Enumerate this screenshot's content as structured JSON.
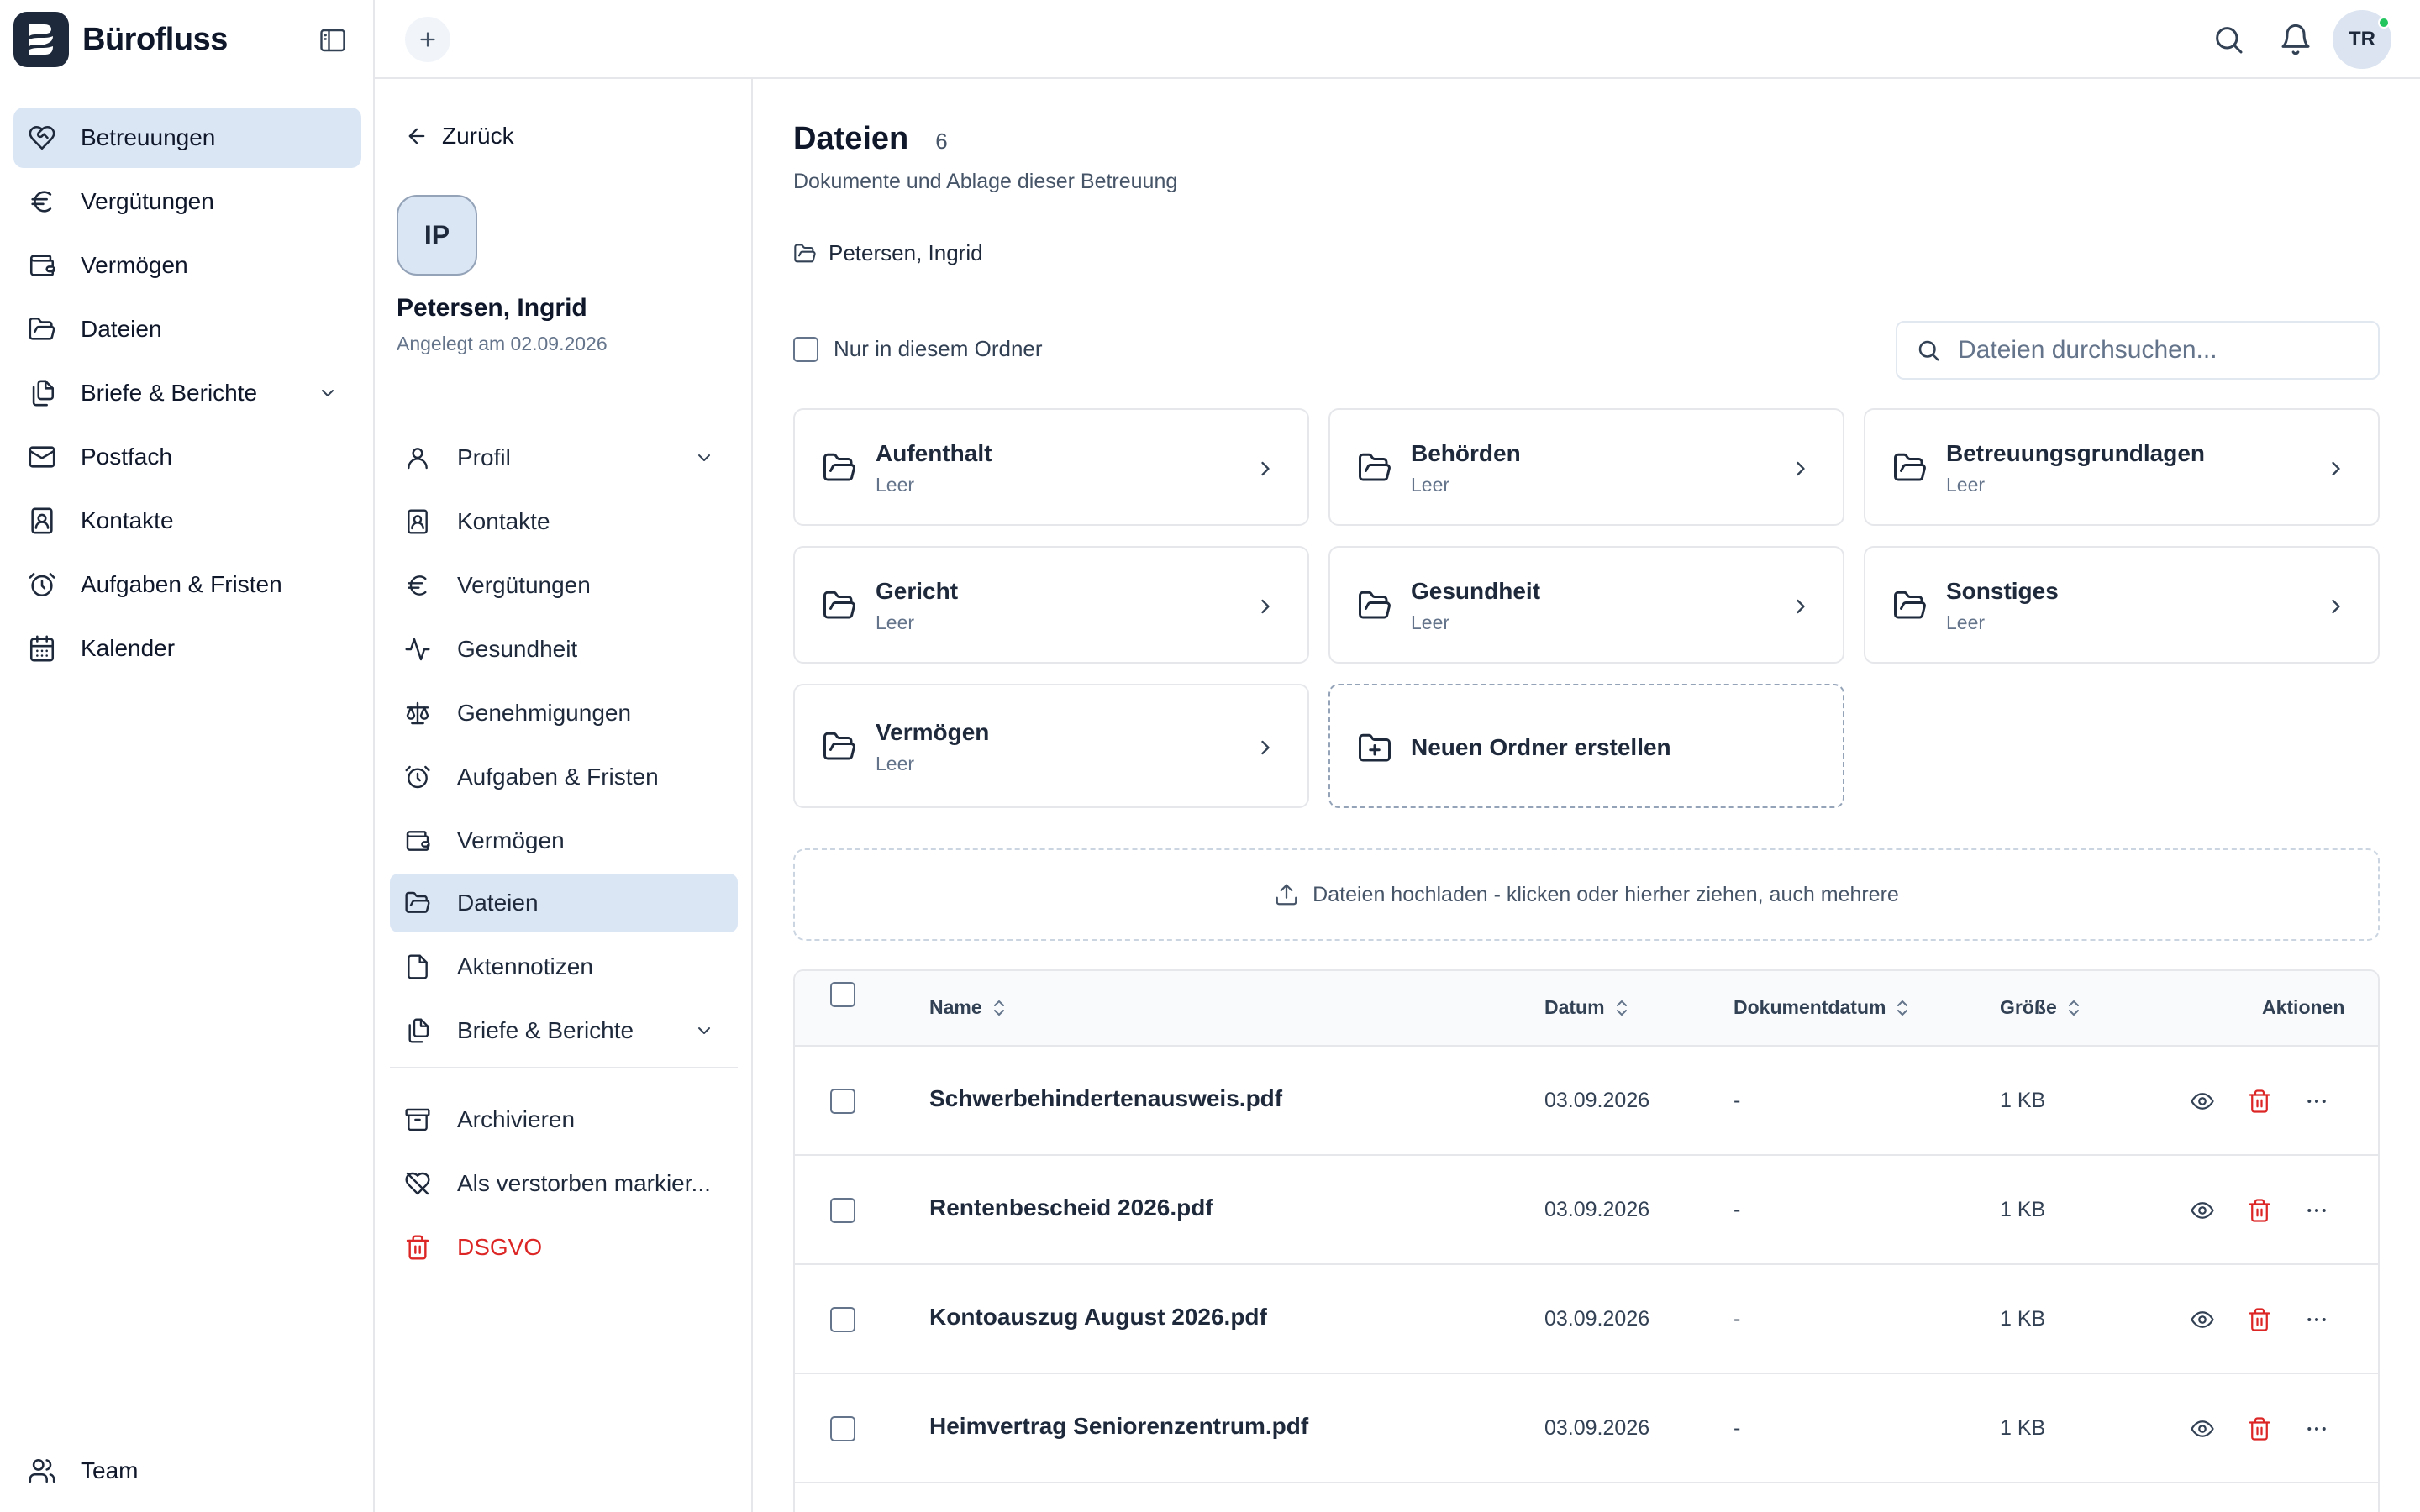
{
  "app": {
    "brand": "Bürofluss"
  },
  "user": {
    "initials": "TR"
  },
  "sidebar": {
    "items": [
      {
        "label": "Betreuungen",
        "icon": "heart-handshake-icon",
        "active": true
      },
      {
        "label": "Vergütungen",
        "icon": "euro-icon"
      },
      {
        "label": "Vermögen",
        "icon": "wallet-icon"
      },
      {
        "label": "Dateien",
        "icon": "folder-open-icon"
      },
      {
        "label": "Briefe & Berichte",
        "icon": "files-icon",
        "expandable": true
      },
      {
        "label": "Postfach",
        "icon": "mail-icon"
      },
      {
        "label": "Kontakte",
        "icon": "contact-icon"
      },
      {
        "label": "Aufgaben & Fristen",
        "icon": "alarm-clock-icon"
      },
      {
        "label": "Kalender",
        "icon": "calendar-icon"
      }
    ],
    "footer": {
      "label": "Team",
      "icon": "users-icon"
    }
  },
  "detail": {
    "back_label": "Zurück",
    "avatar_initials": "IP",
    "name": "Petersen, Ingrid",
    "created": "Angelegt am 02.09.2026",
    "items": [
      {
        "label": "Profil",
        "icon": "user-icon",
        "expandable": true
      },
      {
        "label": "Kontakte",
        "icon": "contact-icon"
      },
      {
        "label": "Vergütungen",
        "icon": "euro-icon"
      },
      {
        "label": "Gesundheit",
        "icon": "activity-icon"
      },
      {
        "label": "Genehmigungen",
        "icon": "scale-icon"
      },
      {
        "label": "Aufgaben & Fristen",
        "icon": "alarm-clock-icon"
      },
      {
        "label": "Vermögen",
        "icon": "wallet-icon"
      },
      {
        "label": "Dateien",
        "icon": "folder-open-icon",
        "active": true
      },
      {
        "label": "Aktennotizen",
        "icon": "file-icon"
      },
      {
        "label": "Briefe & Berichte",
        "icon": "files-icon",
        "expandable": true
      }
    ],
    "actions": [
      {
        "label": "Archivieren",
        "icon": "archive-icon"
      },
      {
        "label": "Als verstorben markier...",
        "icon": "heart-off-icon"
      },
      {
        "label": "DSGVO",
        "icon": "trash-icon",
        "danger": true
      }
    ]
  },
  "main": {
    "title": "Dateien",
    "count": "6",
    "subtitle": "Dokumente und Ablage dieser Betreuung",
    "breadcrumb": "Petersen, Ingrid",
    "filter_label": "Nur in diesem Ordner",
    "search_placeholder": "Dateien durchsuchen...",
    "folders": [
      {
        "name": "Aufenthalt",
        "status": "Leer"
      },
      {
        "name": "Behörden",
        "status": "Leer"
      },
      {
        "name": "Betreuungsgrundlagen",
        "status": "Leer"
      },
      {
        "name": "Gericht",
        "status": "Leer"
      },
      {
        "name": "Gesundheit",
        "status": "Leer"
      },
      {
        "name": "Sonstiges",
        "status": "Leer"
      },
      {
        "name": "Vermögen",
        "status": "Leer"
      }
    ],
    "new_folder_label": "Neuen Ordner erstellen",
    "upload_label": "Dateien hochladen - klicken oder hierher ziehen, auch mehrere",
    "table": {
      "columns": {
        "name": "Name",
        "date": "Datum",
        "doc_date": "Dokumentdatum",
        "size": "Größe",
        "actions": "Aktionen"
      },
      "rows": [
        {
          "name": "Schwerbehindertenausweis.pdf",
          "date": "03.09.2026",
          "doc_date": "-",
          "size": "1 KB"
        },
        {
          "name": "Rentenbescheid 2026.pdf",
          "date": "03.09.2026",
          "doc_date": "-",
          "size": "1 KB"
        },
        {
          "name": "Kontoauszug August 2026.pdf",
          "date": "03.09.2026",
          "doc_date": "-",
          "size": "1 KB"
        },
        {
          "name": "Heimvertrag Seniorenzentrum.pdf",
          "date": "03.09.2026",
          "doc_date": "-",
          "size": "1 KB"
        }
      ]
    }
  },
  "colors": {
    "accent_bg": "#dbe6f5",
    "danger": "#dc2626",
    "brand_dark": "#1e293b",
    "online": "#22c55e"
  }
}
